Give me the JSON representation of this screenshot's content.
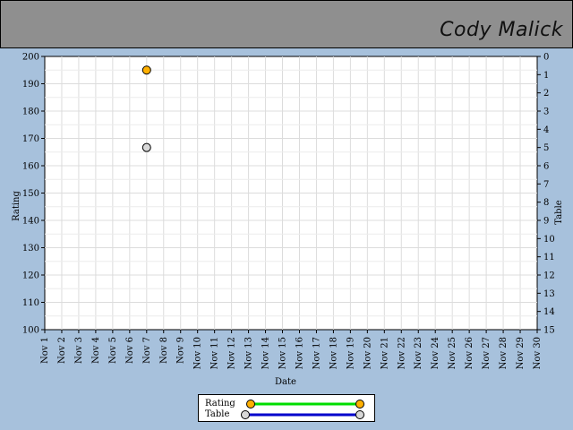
{
  "header": {
    "name": "Cody Malick"
  },
  "legend": {
    "rating_label": "Rating",
    "table_label": "Table"
  },
  "colors": {
    "background": "#a7c1dc",
    "header": "#8f8f8f",
    "rating": "#00dd00",
    "rating_marker": "#ffb000",
    "table": "#0000cc",
    "table_marker": "#d8d8d8",
    "grid": "#dcdcdc"
  },
  "chart_data": {
    "type": "scatter",
    "xlabel": "Date",
    "ylabel": "Rating",
    "y2label": "Table",
    "categories": [
      "Nov 1",
      "Nov 2",
      "Nov 3",
      "Nov 4",
      "Nov 5",
      "Nov 6",
      "Nov 7",
      "Nov 8",
      "Nov 9",
      "Nov 10",
      "Nov 11",
      "Nov 12",
      "Nov 13",
      "Nov 14",
      "Nov 15",
      "Nov 16",
      "Nov 17",
      "Nov 18",
      "Nov 19",
      "Nov 20",
      "Nov 21",
      "Nov 22",
      "Nov 23",
      "Nov 24",
      "Nov 25",
      "Nov 26",
      "Nov 27",
      "Nov 28",
      "Nov 29",
      "Nov 30"
    ],
    "ylim": [
      100,
      200
    ],
    "yticks": [
      100,
      110,
      120,
      130,
      140,
      150,
      160,
      170,
      180,
      190,
      200
    ],
    "y2lim": [
      0,
      15
    ],
    "y2_inverted": true,
    "y2ticks": [
      0,
      1,
      2,
      3,
      4,
      5,
      6,
      7,
      8,
      9,
      10,
      11,
      12,
      13,
      14,
      15
    ],
    "grid": true,
    "legend_position": "bottom-center",
    "series": [
      {
        "name": "Rating",
        "axis": "left",
        "points": [
          {
            "x": "Nov 7",
            "y": 195
          }
        ]
      },
      {
        "name": "Table",
        "axis": "right",
        "points": [
          {
            "x": "Nov 7",
            "y": 5
          }
        ]
      }
    ]
  }
}
